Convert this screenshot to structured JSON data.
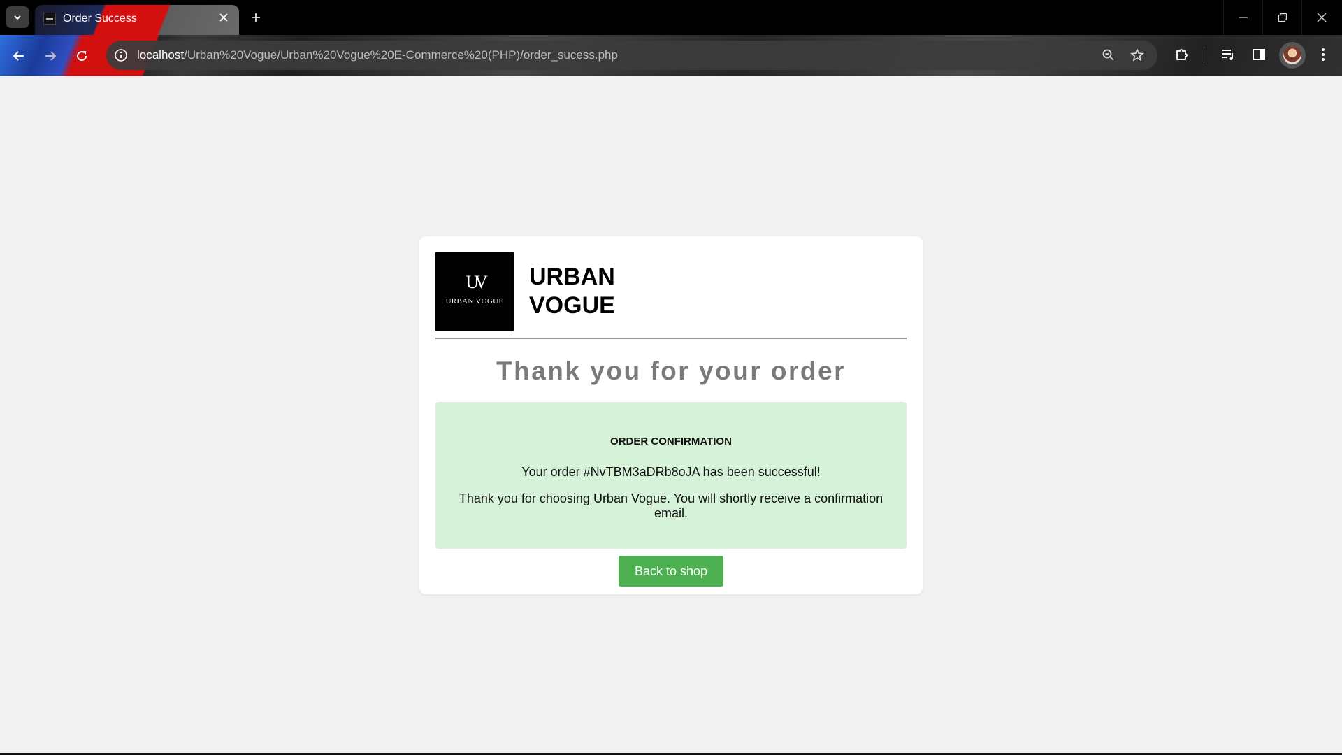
{
  "browser": {
    "tab_title": "Order Success",
    "url_host": "localhost",
    "url_path": "/Urban%20Vogue/Urban%20Vogue%20E-Commerce%20(PHP)/order_sucess.php"
  },
  "brand": {
    "logo_monogram": "UV",
    "logo_text": "URBAN VOGUE",
    "name_line1": "URBAN",
    "name_line2": "VOGUE"
  },
  "page": {
    "heading": "Thank you for your order",
    "confirmation_title": "ORDER CONFIRMATION",
    "confirmation_message": "Your order #NvTBM3aDRb8oJA has been successful!",
    "confirmation_note": "Thank you for choosing Urban Vogue. You will shortly receive a confirmation email.",
    "back_button_label": "Back to shop"
  },
  "colors": {
    "accent_green": "#4caf50",
    "confirm_bg": "#d6f3d9",
    "heading_gray": "#7a7a7a"
  }
}
